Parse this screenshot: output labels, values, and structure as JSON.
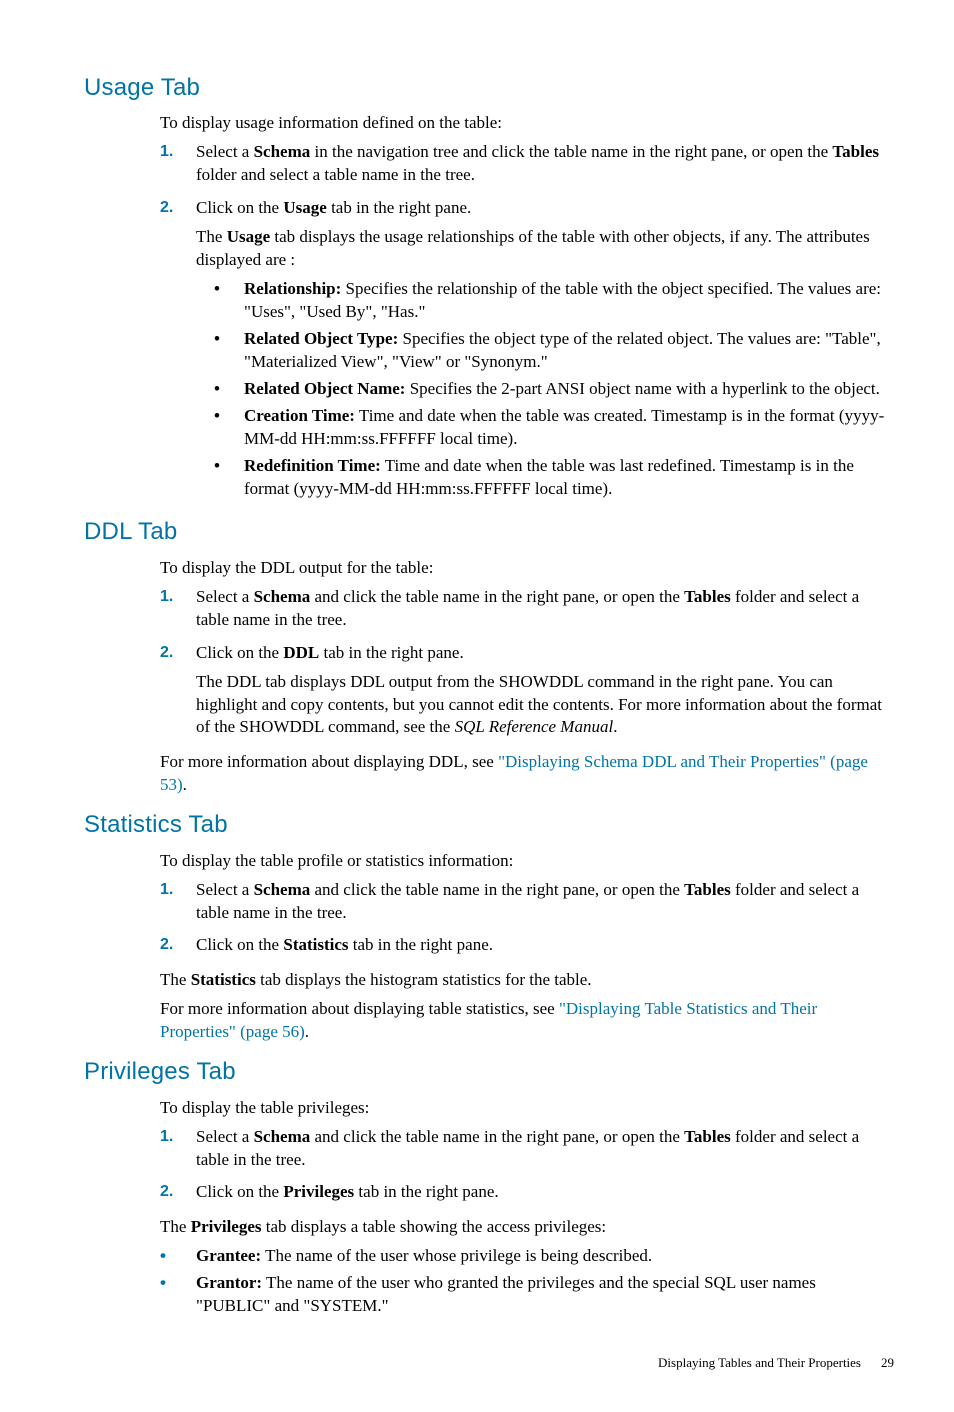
{
  "sections": {
    "usage": {
      "heading": "Usage Tab",
      "intro": "To display usage information defined on the table:",
      "step1_a": "Select a ",
      "step1_b": " in the navigation tree and click the table name in the right pane, or open the ",
      "step1_c": " folder and select a table name in the tree.",
      "schema": "Schema",
      "tables": "Tables",
      "step2_a": "Click on the ",
      "step2_b": " tab in the right pane.",
      "usage_bold": "Usage",
      "step2_p_a": "The ",
      "step2_p_b": " tab displays the usage relationships of the table with other objects, if any. The attributes displayed are :",
      "bullets": {
        "rel_label": "Relationship:",
        "rel_text": " Specifies the relationship of the table with the object specified. The values are: \"Uses\", \"Used By\", \"Has.\"",
        "rotype_label": "Related Object Type:",
        "rotype_text": " Specifies the object type of the related object. The values are: \"Table\", \"Materialized View\", \"View\" or \"Synonym.\"",
        "roname_label": "Related Object Name:",
        "roname_text": " Specifies the 2-part ANSI object name with a hyperlink to the object.",
        "ctime_label": "Creation Time:",
        "ctime_text": " Time and date when the table was created. Timestamp is in the format (yyyy-MM-dd HH:mm:ss.FFFFFF local time).",
        "rtime_label": "Redefinition Time:",
        "rtime_text": " Time and date when the table was last redefined. Timestamp is in the format (yyyy-MM-dd HH:mm:ss.FFFFFF local time)."
      }
    },
    "ddl": {
      "heading": "DDL Tab",
      "intro": "To display the DDL output for the table:",
      "step1_a": "Select a ",
      "step1_b": " and click the table name in the right pane, or open the ",
      "step1_c": " folder and select a table name in the tree.",
      "schema": "Schema",
      "tables": "Tables",
      "step2_a": "Click on the ",
      "step2_b": " tab in the right pane.",
      "ddl_bold": "DDL",
      "step2_p1": "The DDL tab displays DDL output from the SHOWDDL command in the right pane. You can highlight and copy contents, but you cannot edit the contents. For more information about the format of the SHOWDDL command, see the ",
      "step2_p1_ital": "SQL Reference Manual",
      "step2_p1_end": ".",
      "more_a": "For more information about displaying DDL, see ",
      "more_link": "\"Displaying Schema DDL and Their Properties\" (page 53)",
      "more_end": "."
    },
    "stats": {
      "heading": "Statistics Tab",
      "intro": "To display the table profile or statistics information:",
      "step1_a": "Select a ",
      "step1_b": " and click the table name in the right pane, or open the ",
      "step1_c": " folder and select a table name in the tree.",
      "schema": "Schema",
      "tables": "Tables",
      "step2_a": "Click on the ",
      "step2_b": " tab in the right pane.",
      "stats_bold": "Statistics",
      "p3_a": "The ",
      "p3_b": " tab displays the histogram statistics for the table.",
      "more_a": "For more information about displaying table statistics, see ",
      "more_link": "\"Displaying Table Statistics and Their Properties\" (page 56)",
      "more_end": "."
    },
    "priv": {
      "heading": "Privileges Tab",
      "intro": "To display the table privileges:",
      "step1_a": "Select a ",
      "step1_b": " and click the table name in the right pane, or open the ",
      "step1_c": " folder and select a table in the tree.",
      "schema": "Schema",
      "tables": "Tables",
      "step2_a": "Click on the ",
      "step2_b": " tab in the right pane.",
      "priv_bold": "Privileges",
      "p3_a": "The ",
      "p3_b": " tab displays a table showing the access privileges:",
      "bullets": {
        "grantee_label": "Grantee:",
        "grantee_text": " The name of the user whose privilege is being described.",
        "grantor_label": "Grantor:",
        "grantor_text": " The name of the user who granted the privileges and the special SQL user names \"PUBLIC\" and \"SYSTEM.\""
      }
    }
  },
  "nums": {
    "n1": "1.",
    "n2": "2."
  },
  "footer": {
    "title": "Displaying Tables and Their Properties",
    "page": "29"
  }
}
